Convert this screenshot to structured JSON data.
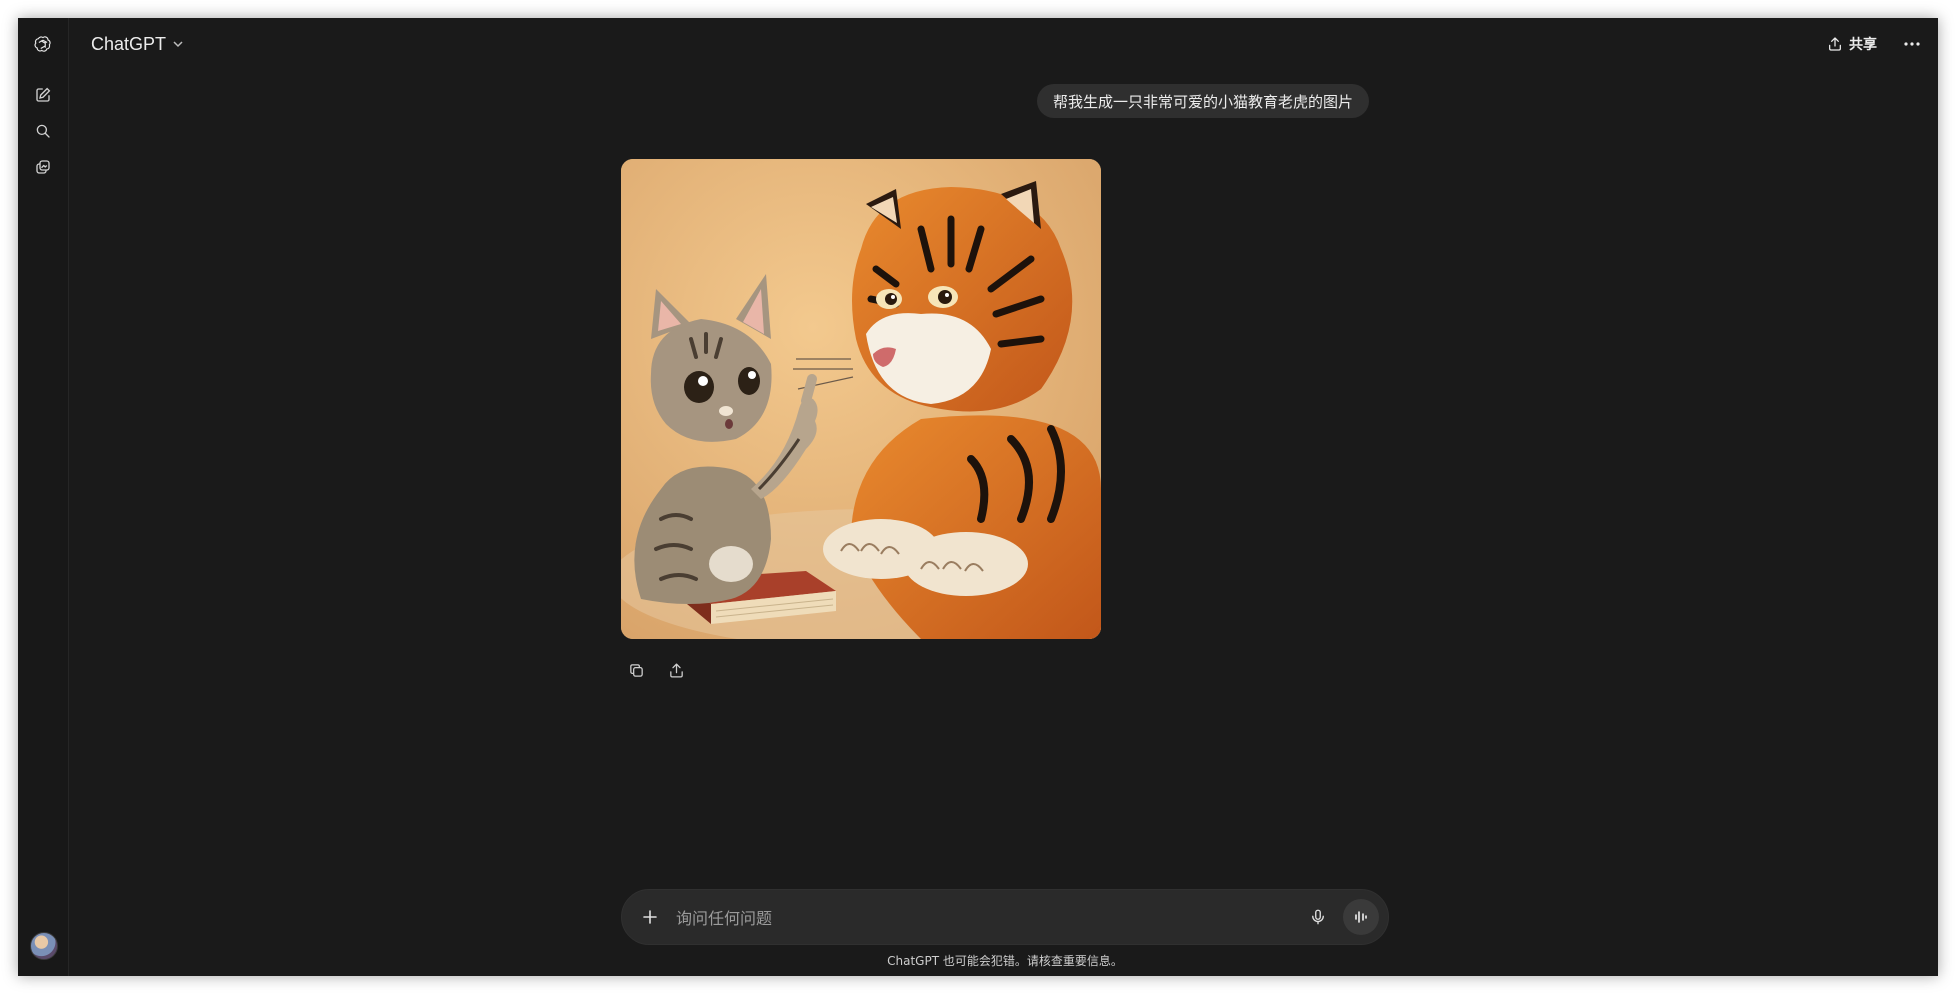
{
  "header": {
    "model_name": "ChatGPT",
    "share_label": "共享"
  },
  "sidebar": {
    "icons": [
      "openai-logo-icon",
      "new-chat-icon",
      "search-icon",
      "library-icon"
    ]
  },
  "conversation": {
    "user_message": "帮我生成一只非常可爱的小猫教育老虎的图片"
  },
  "composer": {
    "placeholder": "询问任何问题"
  },
  "footer": {
    "disclaimer": "ChatGPT 也可能会犯错。请核查重要信息。"
  },
  "colors": {
    "background": "#1a1a1a",
    "sidebar": "#181818",
    "bubble": "#2f2f2f",
    "text": "#ececec"
  }
}
